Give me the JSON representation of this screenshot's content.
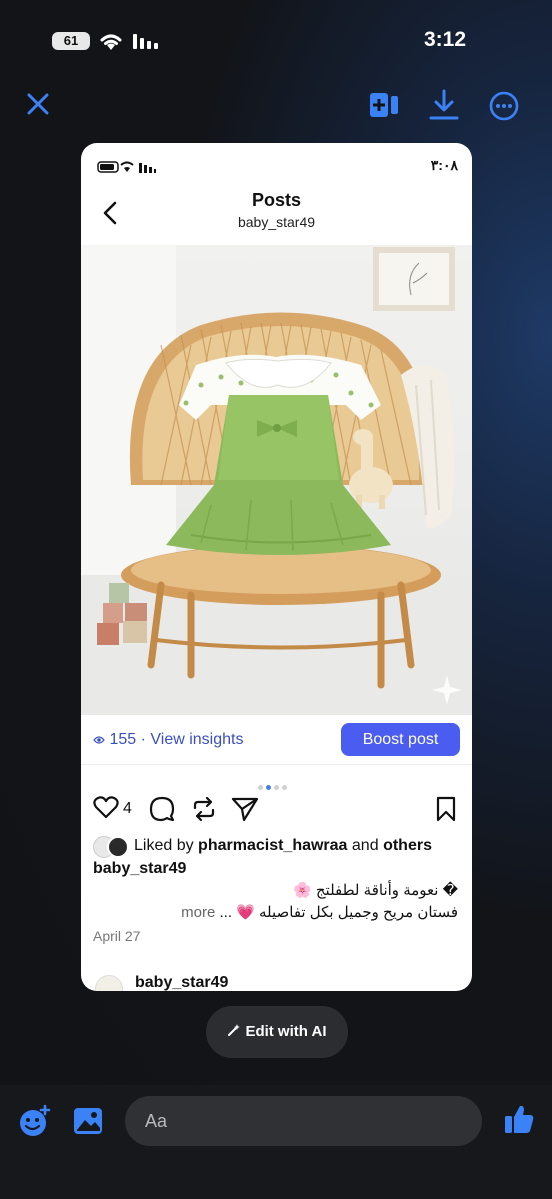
{
  "status_bar": {
    "time": "3:12",
    "battery": "61"
  },
  "toolbar": {
    "close_icon": "close-icon",
    "add_icon": "add-to-story-icon",
    "download_icon": "download-icon",
    "more_icon": "more-options-icon",
    "accent_color": "#3b82f6"
  },
  "screenshot": {
    "status_time": "٣:٠٨",
    "header": {
      "title": "Posts",
      "username": "baby_star49"
    },
    "insights": {
      "views": "155",
      "separator": "·",
      "link": "View insights",
      "boost_label": "Boost post"
    },
    "actions": {
      "like_count": "4"
    },
    "carousel": {
      "pages": 4,
      "active": 2
    },
    "liked_by": {
      "prefix": "Liked by",
      "user": "pharmacist_hawraa",
      "and": "and",
      "others": "others"
    },
    "caption": {
      "username": "baby_star49",
      "line1": "� نعومة وأناقة لطفلتج 🌸",
      "line2": "فستان مريح وجميل بكل تفاصيله 💗 ...",
      "more": "more"
    },
    "date": "April 27",
    "next_post_user": "baby_star49"
  },
  "edit_ai": {
    "label": "Edit with AI"
  },
  "composer": {
    "placeholder": "Aa"
  }
}
